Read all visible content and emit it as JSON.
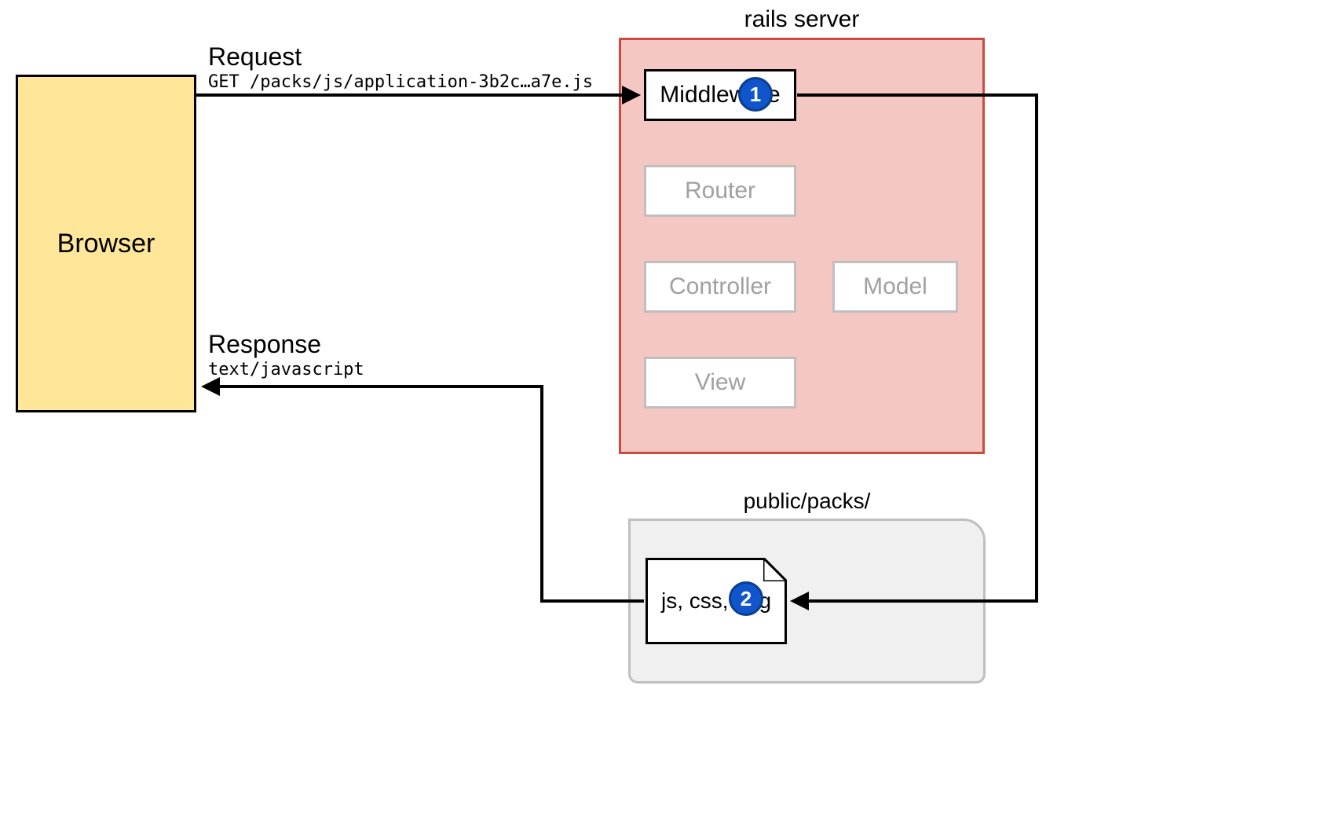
{
  "browser": {
    "label": "Browser"
  },
  "request": {
    "title": "Request",
    "line": "GET /packs/js/application-3b2c…a7e.js"
  },
  "response": {
    "title": "Response",
    "line": "text/javascript"
  },
  "server": {
    "title": "rails server",
    "middleware": "Middleware",
    "router": "Router",
    "controller": "Controller",
    "model": "Model",
    "view": "View"
  },
  "folder": {
    "title": "public/packs/",
    "file_label": "js, css, png"
  },
  "badges": {
    "one": "1",
    "two": "2"
  }
}
